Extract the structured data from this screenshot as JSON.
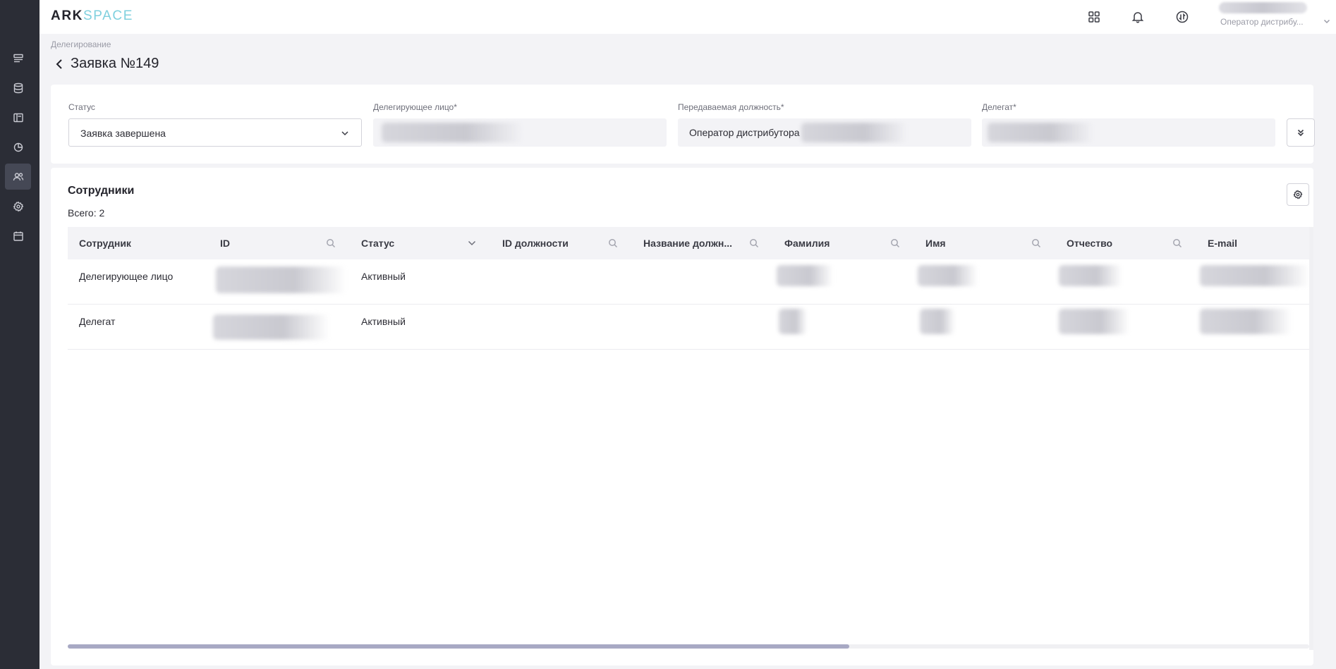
{
  "app": {
    "logo_ark": "ARK",
    "logo_space": "SPACE"
  },
  "sidebar": {
    "items": [
      {
        "icon": "list-icon",
        "active": false
      },
      {
        "icon": "database-icon",
        "active": false
      },
      {
        "icon": "layout-icon",
        "active": false
      },
      {
        "icon": "pie-chart-icon",
        "active": false
      },
      {
        "icon": "users-icon",
        "active": true
      },
      {
        "icon": "gear-icon",
        "active": false
      },
      {
        "icon": "calendar-icon",
        "active": false
      }
    ]
  },
  "topbar": {
    "user_role": "Оператор дистрибу..."
  },
  "page": {
    "breadcrumb": "Делегирование",
    "title": "Заявка №149"
  },
  "filters": {
    "status_label": "Статус",
    "status_value": "Заявка завершена",
    "delegator_label": "Делегирующее лицо*",
    "position_label": "Передаваемая должность*",
    "position_value": "Оператор дистрибутора",
    "delegate_label": "Делегат*"
  },
  "employees": {
    "title": "Сотрудники",
    "total": "Всего: 2",
    "columns": [
      {
        "label": "Сотрудник",
        "icon": ""
      },
      {
        "label": "ID",
        "icon": "search-icon"
      },
      {
        "label": "Статус",
        "icon": "chevron-down-icon"
      },
      {
        "label": "ID должности",
        "icon": "search-icon"
      },
      {
        "label": "Название должн...",
        "icon": "search-icon"
      },
      {
        "label": "Фамилия",
        "icon": "search-icon"
      },
      {
        "label": "Имя",
        "icon": "search-icon"
      },
      {
        "label": "Отчество",
        "icon": "search-icon"
      },
      {
        "label": "E-mail",
        "icon": ""
      }
    ],
    "rows": [
      {
        "employee": "Делегирующее лицо",
        "status": "Активный"
      },
      {
        "employee": "Делегат",
        "status": "Активный"
      }
    ]
  },
  "scrollbar": {
    "visible_fraction": 0.63
  }
}
